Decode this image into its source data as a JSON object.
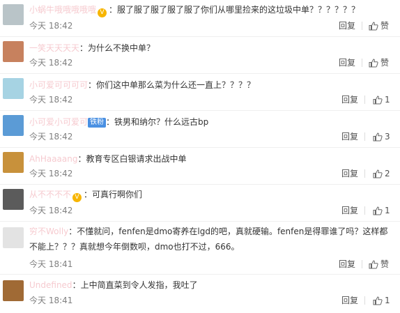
{
  "comments": [
    {
      "user": "小蜗牛哦哦哦哦哦",
      "badge": "",
      "text": "服了服了服了服了服了你们从哪里捡来的这垃圾中单？？？？？？",
      "time": "今天 18:42",
      "reply": "回复",
      "likes": "赞",
      "avatar_color": "#b9c4c8"
    },
    {
      "user": "一笑天天天天",
      "badge": "",
      "text": "为什么不换中单？",
      "time": "今天 18:42",
      "reply": "回复",
      "likes": "赞",
      "avatar_color": "#c7815e"
    },
    {
      "user": "小可爱可可可可",
      "badge": "",
      "text": "你们这中单那么菜为什么还一直上？？？？",
      "time": "今天 18:42",
      "reply": "回复",
      "likes": "1",
      "avatar_color": "#a6d3e3"
    },
    {
      "user": "小可爱小可爱可",
      "badge": "铁粉",
      "text": "铁男和纳尔？什么远古bp",
      "time": "今天 18:42",
      "reply": "回复",
      "likes": "3",
      "avatar_color": "#5b9bd6"
    },
    {
      "user": "AhHaaaang",
      "badge": "",
      "text": "教育专区白银请求出战中单",
      "time": "今天 18:42",
      "reply": "回复",
      "likes": "2",
      "avatar_color": "#c8913b"
    },
    {
      "user": "从不不不不",
      "badge": "",
      "text": "可真行啊你们",
      "time": "今天 18:42",
      "reply": "回复",
      "likes": "1",
      "avatar_color": "#5b5b5b"
    },
    {
      "user": "穷不Wolly",
      "badge": "",
      "text": "不懂就问，fenfen是dmo寄养在lgd的吧，真就硬输。fenfen是得罪谁了吗？这样都不能上？？？真就想今年倒数呗，dmo也打不过，666。",
      "time": "今天 18:41",
      "reply": "回复",
      "likes": "赞",
      "avatar_color": "#e3e3e3"
    },
    {
      "user": "Undefined",
      "badge": "",
      "text": "上中简直菜到令人发指，我吐了",
      "time": "今天 18:41",
      "reply": "回复",
      "likes": "1",
      "avatar_color": "#a06a35"
    }
  ]
}
